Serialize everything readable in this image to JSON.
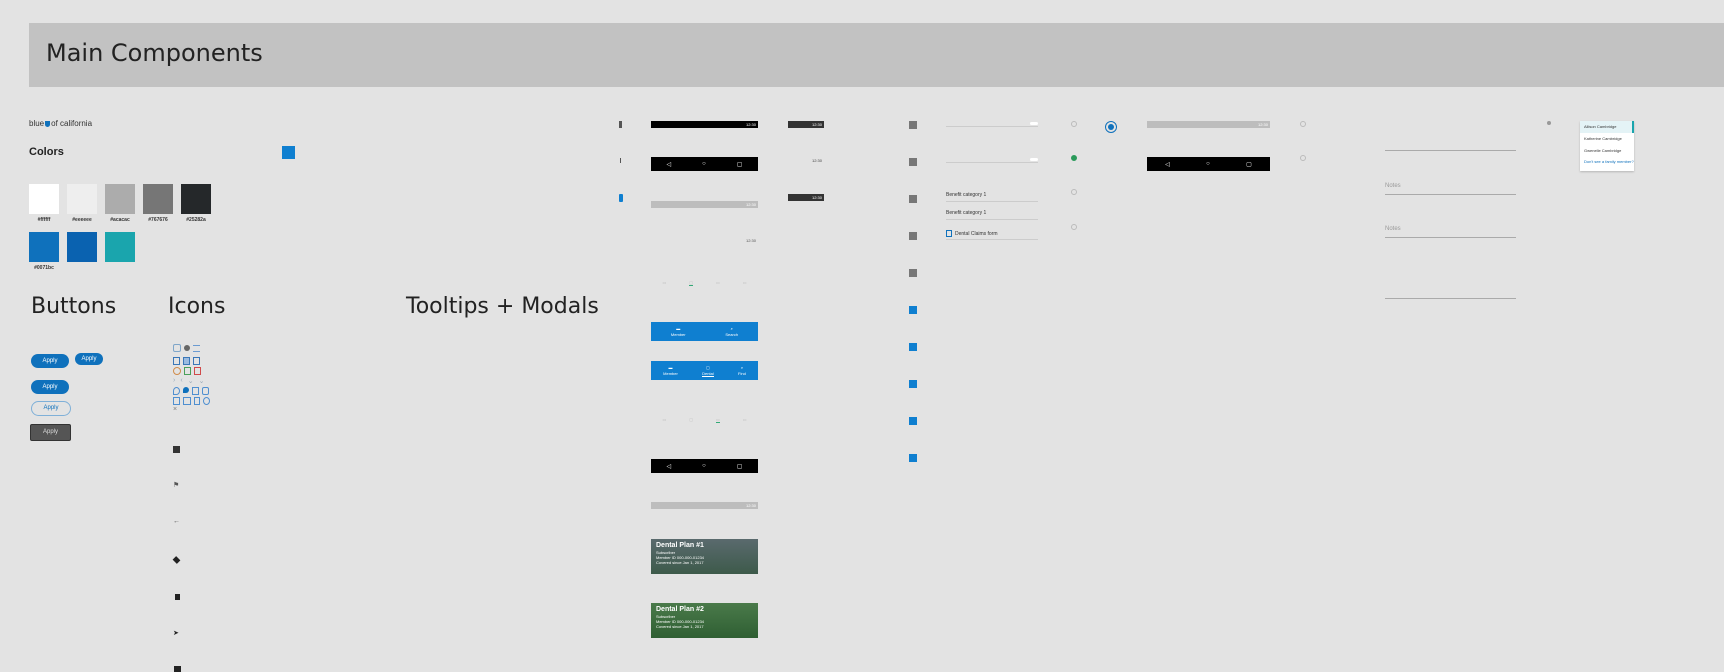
{
  "banner": {
    "title": "Main Components"
  },
  "logo": {
    "text_pre": "blue",
    "text_post": "of california"
  },
  "colors": {
    "heading": "Colors",
    "swatches_row1": [
      {
        "hex": "#ffffff",
        "label": "#ffffff"
      },
      {
        "hex": "#eeeeee",
        "label": "#eeeeee"
      },
      {
        "hex": "#acacac",
        "label": "#acacac"
      },
      {
        "hex": "#767676",
        "label": "#767676"
      },
      {
        "hex": "#25282a",
        "label": "#25282a"
      }
    ],
    "swatches_row2": [
      {
        "hex": "#0f71bc",
        "label": "#0071bc"
      },
      {
        "hex": "#0a62b0",
        "label": ""
      },
      {
        "hex": "#1aa5ad",
        "label": ""
      }
    ],
    "accent": "#0f7fd0"
  },
  "sections": {
    "buttons": "Buttons",
    "icons": "Icons",
    "tooltips": "Tooltips + Modals"
  },
  "buttons": {
    "apply1": "Apply",
    "apply2": "Apply",
    "apply3": "Apply",
    "apply4": "Apply",
    "apply5": "Apply"
  },
  "phone": {
    "time": "12:30",
    "status_time2": "12:30",
    "tabs_blue_1": [
      "Member",
      "Search"
    ],
    "tabs_blue_2": [
      "Member",
      "Dental",
      "Find"
    ]
  },
  "cards": [
    {
      "title": "Dental Plan #1",
      "line1": "Subscriber",
      "line2": "Member ID 000-000-01234",
      "line3": "Covered since Jan 1, 2017"
    },
    {
      "title": "Dental Plan #2",
      "line1": "Subscriber",
      "line2": "Member ID 000-000-01234",
      "line3": "Covered since Jan 1, 2017"
    }
  ],
  "list": {
    "item1": "Benefit category 1",
    "item2": "Benefit category 1",
    "item3": "Dental Claims form"
  },
  "form": {
    "notes1": "Notes",
    "notes2": "Notes"
  },
  "menu": {
    "items": [
      "Allison Cambridge",
      "Katherine Cambridge",
      "Gwenelle Cambridge"
    ],
    "link": "Don't see a family member?"
  }
}
